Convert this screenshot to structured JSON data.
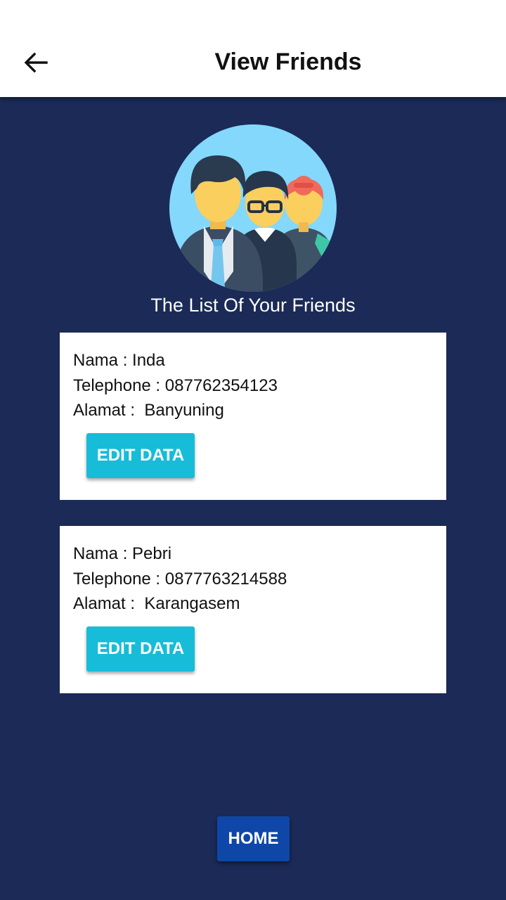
{
  "appbar": {
    "title": "View Friends",
    "back_icon": "arrow-left-icon"
  },
  "header": {
    "illustration_icon": "friends-group-icon",
    "subtitle": "The List Of Your Friends"
  },
  "friends": [
    {
      "nama_line": "Nama : Inda",
      "telephone_line": "Telephone : 087762354123",
      "alamat_line": "Alamat :  Banyuning",
      "edit_label": "EDIT DATA"
    },
    {
      "nama_line": "Nama : Pebri",
      "telephone_line": "Telephone : 0877763214588",
      "alamat_line": "Alamat :  Karangasem",
      "edit_label": "EDIT DATA"
    }
  ],
  "footer": {
    "home_label": "HOME"
  },
  "colors": {
    "background": "#1b2a57",
    "appbar": "#ffffff",
    "edit_button": "#17bcd8",
    "home_button": "#0f47a8"
  }
}
